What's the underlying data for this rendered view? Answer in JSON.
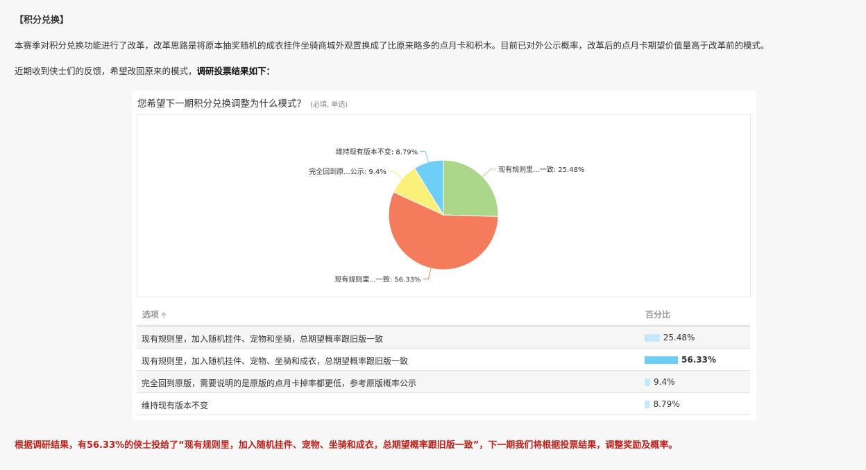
{
  "article": {
    "heading": "【积分兑换】",
    "para1": "本赛季对积分兑换功能进行了改革，改革思路是将原本抽奖随机的成衣挂件坐骑商城外观置换成了比原来略多的点月卡和积木。目前已对外公示概率，改革后的点月卡期望价值量高于改革前的模式。",
    "para2_plain": "近期收到侠士们的反馈，希望改回原来的模式，",
    "para2_bold": "调研投票结果如下：",
    "conclusion": "根据调研结果，有56.33%的侠士投给了“现有规则里，加入随机挂件、宠物、坐骑和成衣，总期望概率跟旧版一致”，下一期我们将根据投票结果，调整奖励及概率。"
  },
  "survey": {
    "question": "您希望下一期积分兑换调整为什么模式？",
    "hint": "(必填, 单选)",
    "table": {
      "col_option": "选项",
      "col_percent": "百分比",
      "rows": [
        {
          "option": "现有规则里，加入随机挂件、宠物和坐骑，总期望概率跟旧版一致",
          "percent": "25.48%",
          "value": 25.48,
          "highlight": false
        },
        {
          "option": "现有规则里，加入随机挂件、宠物、坐骑和成衣，总期望概率跟旧版一致",
          "percent": "56.33%",
          "value": 56.33,
          "highlight": true
        },
        {
          "option": "完全回到原版，需要说明的是原版的点月卡掉率都更低，参考原版概率公示",
          "percent": "9.4%",
          "value": 9.4,
          "highlight": false
        },
        {
          "option": "维持现有版本不变",
          "percent": "8.79%",
          "value": 8.79,
          "highlight": false
        }
      ]
    }
  },
  "chart_data": {
    "type": "pie",
    "slices": [
      {
        "label": "现有规则里...一致: 25.48%",
        "value": 25.48,
        "color": "#acd68a"
      },
      {
        "label": "现有规则里...一致: 56.33%",
        "value": 56.33,
        "color": "#f47c5c"
      },
      {
        "label": "完全回到原...公示: 9.4%",
        "value": 9.4,
        "color": "#fbf17a"
      },
      {
        "label": "维持现有版本不变: 8.79%",
        "value": 8.79,
        "color": "#6ecef6"
      }
    ],
    "start": "12 o'clock, clockwise"
  },
  "colors": {
    "bar_normal": "#c6e8fb",
    "bar_highlight": "#6ecef6",
    "conclusion": "#c0201a"
  }
}
